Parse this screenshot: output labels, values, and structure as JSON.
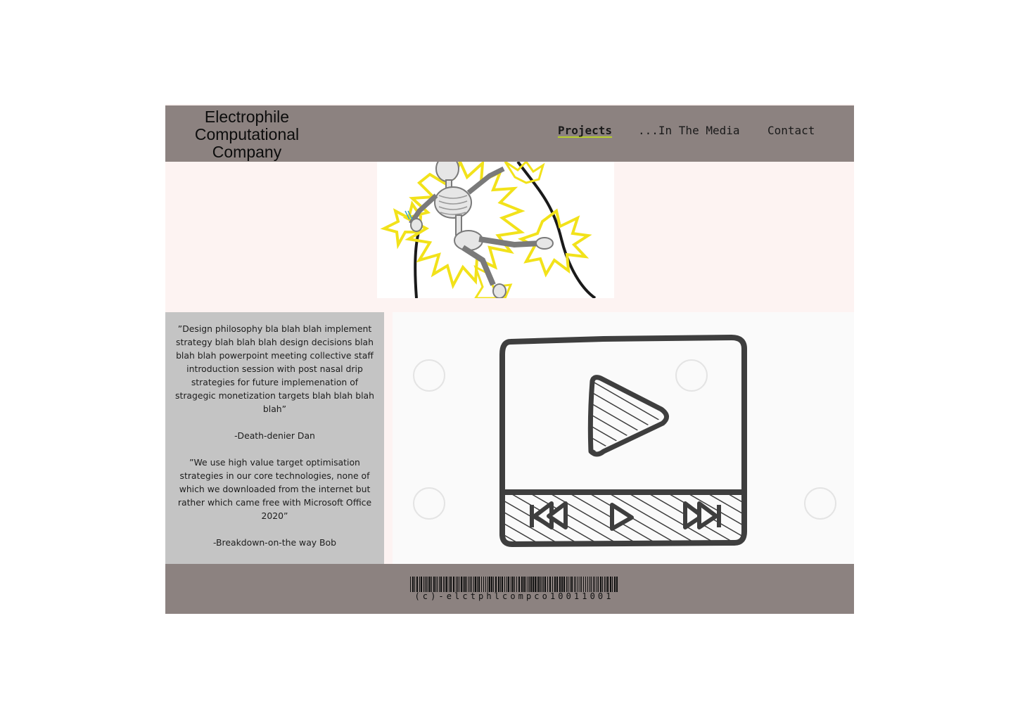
{
  "header": {
    "logo_line1": "Electrophile",
    "logo_line2": "Computational",
    "logo_line3": "Company",
    "nav": [
      {
        "label": "Projects",
        "active": true
      },
      {
        "label": "...In The Media",
        "active": false
      },
      {
        "label": "Contact",
        "active": false
      }
    ]
  },
  "quotes": [
    {
      "text": "”Design philosophy bla blah blah implement strategy blah blah blah design decisions blah blah blah powerpoint meeting collective staff introduction session with post nasal drip strategies for future implemenation of stragegic monetization targets blah blah blah blah”",
      "author": "-Death-denier Dan"
    },
    {
      "text": "”We use high value target optimisation strategies in our core technologies, none of which we downloaded from the internet but rather which came free with Microsoft Office 2020”",
      "author": "-Breakdown-on-the way Bob"
    }
  ],
  "footer": {
    "barcode_text": "(c)-elctphlcompco10011001"
  },
  "colors": {
    "header_bg": "#8c8280",
    "page_bg": "#fdf3f2",
    "quotes_bg": "#c4c4c4",
    "nav_underline": "#b7cf2a",
    "spark_yellow": "#f2e21a"
  },
  "icons": {
    "hero": "electrocuted-skeleton-illustration",
    "video": "video-player-sketch-icon"
  }
}
